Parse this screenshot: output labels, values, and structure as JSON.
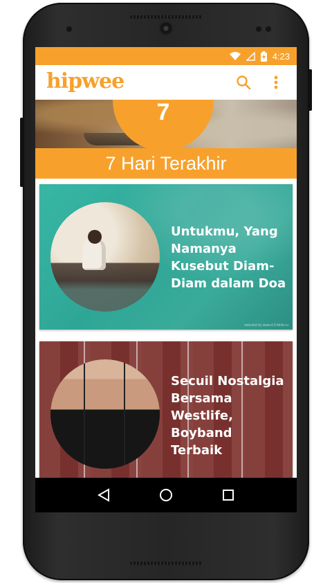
{
  "status_bar": {
    "time": "4:23",
    "icons": [
      "wifi-icon",
      "signal-icon",
      "battery-charging-icon"
    ]
  },
  "app_bar": {
    "logo_text": "hipwee",
    "icons": [
      "search-icon",
      "overflow-menu-icon"
    ]
  },
  "hero": {
    "badge_text": "7"
  },
  "section": {
    "title": "7 Hari Terakhir"
  },
  "articles": [
    {
      "title": "Untukmu, Yang\nNamanya\nKusebut Diam-\nDiam dalam Doa",
      "credit": "selected by www.4.0 bfnfo.ru"
    },
    {
      "title": "Secuil Nostalgia\nBersama\nWestlife,\nBoyband\nTerbaik"
    }
  ],
  "nav_bar": {
    "icons": [
      "back-icon",
      "home-icon",
      "recents-icon"
    ]
  },
  "colors": {
    "accent": "#f7a12c",
    "card_teal": "#38b7a5",
    "card_maroon": "#732426"
  }
}
